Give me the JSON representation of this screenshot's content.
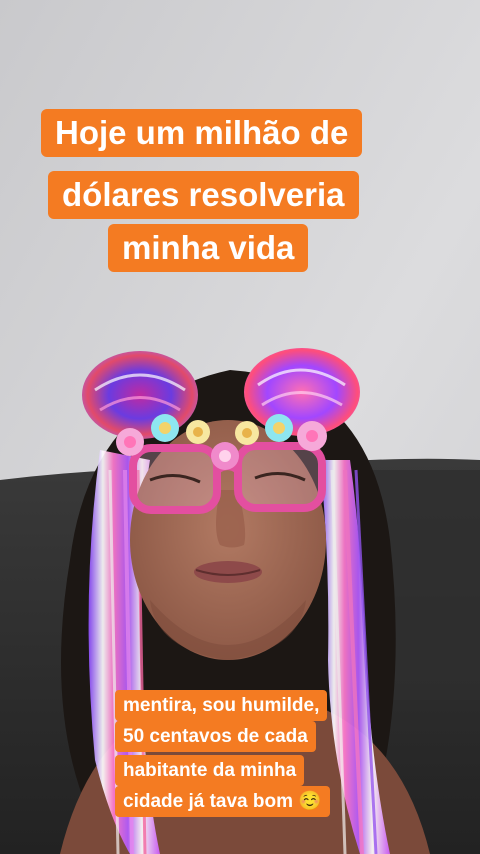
{
  "overlay_text": {
    "top_caption": [
      "Hoje um milhão de",
      "dólares resolveria",
      "minha vida"
    ],
    "bottom_caption": [
      "mentira, sou humilde,",
      "50 centavos de cada",
      "habitante da minha",
      "cidade já tava bom ☺️"
    ]
  },
  "colors": {
    "caption_bg": "#f47b22",
    "caption_text": "#ffffff",
    "wall": "#cfcfd1",
    "sofa": "#333333"
  },
  "photo": {
    "filter": "flower-crown-glasses-rainbow-hair"
  }
}
